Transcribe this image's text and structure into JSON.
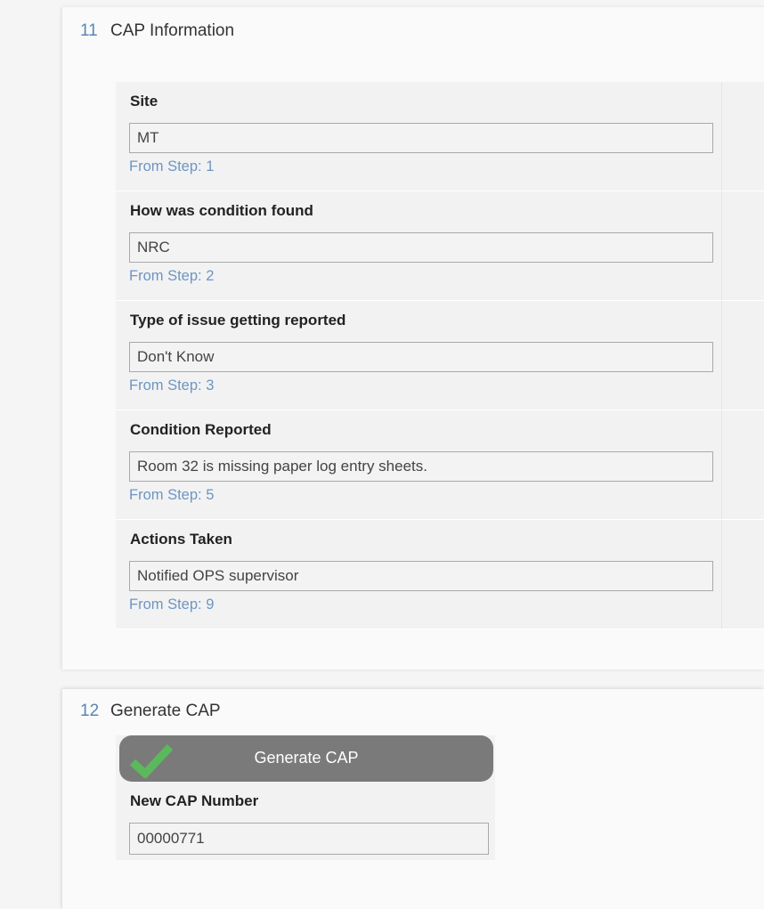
{
  "step11": {
    "number": "11",
    "title": "CAP Information",
    "fields": [
      {
        "label": "Site",
        "value": "MT",
        "from": "From Step: 1"
      },
      {
        "label": "How was condition found",
        "value": "NRC",
        "from": "From Step: 2"
      },
      {
        "label": "Type of issue getting reported",
        "value": "Don't Know",
        "from": "From Step: 3"
      },
      {
        "label": "Condition Reported",
        "value": "Room 32 is missing paper log entry sheets.",
        "from": "From Step: 5"
      },
      {
        "label": "Actions Taken",
        "value": "Notified OPS supervisor",
        "from": "From Step: 9"
      }
    ]
  },
  "step12": {
    "number": "12",
    "title": "Generate CAP",
    "button_label": "Generate CAP",
    "button_icon": "checkmark-icon",
    "cap_label": "New CAP Number",
    "cap_value": "00000771"
  },
  "colors": {
    "step_number": "#5a86b5",
    "from_step_link": "#6d95c4",
    "button_bg": "#7a7a7a",
    "check_green": "#5cb85c"
  }
}
